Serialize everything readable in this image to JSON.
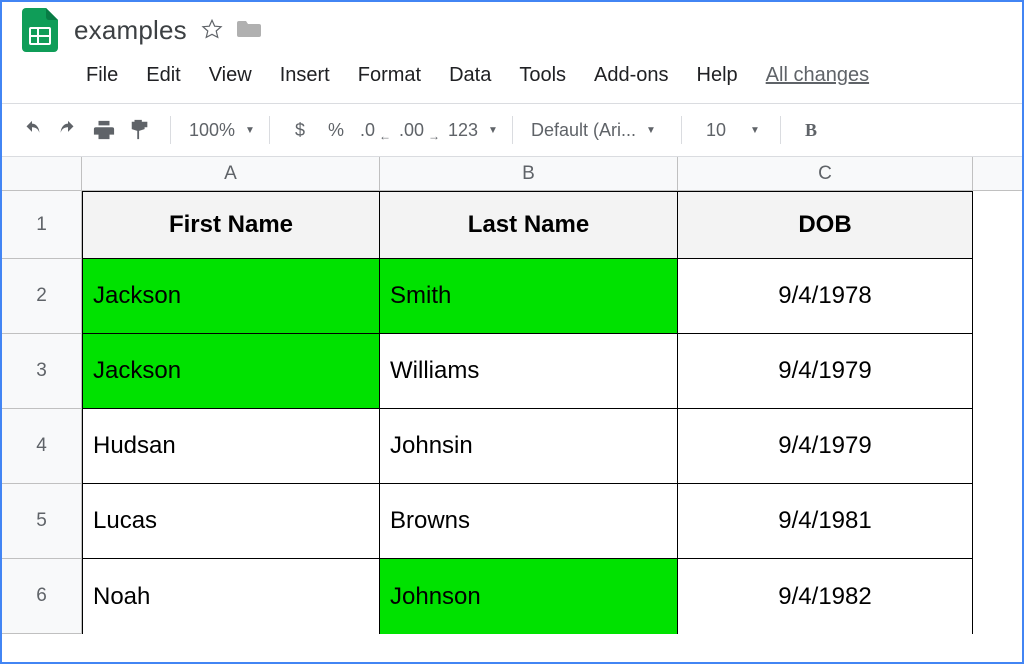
{
  "document": {
    "title": "examples"
  },
  "menu": {
    "file": "File",
    "edit": "Edit",
    "view": "View",
    "insert": "Insert",
    "format": "Format",
    "data": "Data",
    "tools": "Tools",
    "addons": "Add-ons",
    "help": "Help",
    "all_changes": "All changes"
  },
  "toolbar": {
    "zoom": "100%",
    "currency": "$",
    "percent": "%",
    "dec_decrease": ".0",
    "dec_increase": ".00",
    "more_formats": "123",
    "font_name": "Default (Ari...",
    "font_size": "10",
    "bold": "B"
  },
  "columns": {
    "A": "A",
    "B": "B",
    "C": "C"
  },
  "row_numbers": [
    "1",
    "2",
    "3",
    "4",
    "5",
    "6"
  ],
  "header_row": {
    "A": "First Name",
    "B": "Last Name",
    "C": "DOB"
  },
  "rows": [
    {
      "A": "Jackson",
      "B": "Smith",
      "C": "9/4/1978",
      "hl": {
        "A": true,
        "B": true,
        "C": false
      }
    },
    {
      "A": "Jackson",
      "B": "Williams",
      "C": "9/4/1979",
      "hl": {
        "A": true,
        "B": false,
        "C": false
      }
    },
    {
      "A": "Hudsan",
      "B": "Johnsin",
      "C": "9/4/1979",
      "hl": {
        "A": false,
        "B": false,
        "C": false
      }
    },
    {
      "A": "Lucas",
      "B": "Browns",
      "C": "9/4/1981",
      "hl": {
        "A": false,
        "B": false,
        "C": false
      }
    },
    {
      "A": "Noah",
      "B": "Johnson",
      "C": "9/4/1982",
      "hl": {
        "A": false,
        "B": true,
        "C": false
      }
    }
  ],
  "colors": {
    "highlight": "#00e200",
    "brand_green": "#0f9d58"
  }
}
